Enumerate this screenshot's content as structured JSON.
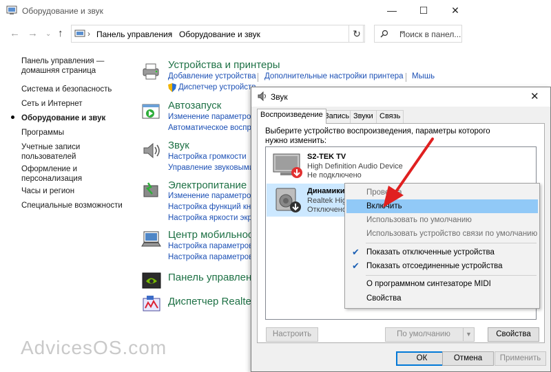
{
  "control_panel": {
    "window_title": "Оборудование и звук",
    "breadcrumb": [
      "Панель управления",
      "Оборудование и звук"
    ],
    "search_placeholder": "Поиск в панел...",
    "sidebar": [
      "Панель управления —",
      "домашняя страница",
      "Система и безопасность",
      "Сеть и Интернет",
      "Оборудование и звук",
      "Программы",
      "Учетные записи",
      "пользователей",
      "Оформление и",
      "персонализация",
      "Часы и регион",
      "Специальные возможности"
    ],
    "categories": [
      {
        "title": "Устройства и принтеры",
        "links": [
          "Добавление устройства",
          "Дополнительные настройки принтера",
          "Мышь",
          "Диспетчер устройств"
        ]
      },
      {
        "title": "Автозапуск",
        "links": [
          "Изменение параметров",
          "Автоматическое воспро"
        ]
      },
      {
        "title": "Звук",
        "links": [
          "Настройка громкости",
          "Управление звуковыми"
        ]
      },
      {
        "title": "Электропитание",
        "links": [
          "Изменение параметров",
          "Настройка функций кно",
          "Настройка яркости экра"
        ]
      },
      {
        "title": "Центр мобильност",
        "links": [
          "Настройка параметров",
          "Настройка параметров"
        ]
      },
      {
        "title": "Панель управлени",
        "links": []
      },
      {
        "title": "Диспетчер Realtek",
        "links": []
      }
    ]
  },
  "sound_dialog": {
    "title": "Звук",
    "tabs": [
      "Воспроизведение",
      "Запись",
      "Звуки",
      "Связь"
    ],
    "instruction": "Выберите устройство воспроизведения, параметры которого нужно изменить:",
    "devices": [
      {
        "name": "S2-TEK TV",
        "description": "High Definition Audio Device",
        "status": "Не подключено"
      },
      {
        "name": "Динамики",
        "description": "Realtek High",
        "status": "Отключено"
      }
    ],
    "buttons": {
      "configure": "Настроить",
      "set_default": "По умолчанию",
      "properties": "Свойства",
      "ok": "ОК",
      "cancel": "Отмена",
      "apply": "Применить"
    }
  },
  "context_menu": {
    "items": [
      {
        "label": "Проверка",
        "disabled": true
      },
      {
        "label": "Включить",
        "highlighted": true
      },
      {
        "label": "Использовать по умолчанию",
        "disabled": true
      },
      {
        "label": "Использовать устройство связи по умолчанию",
        "disabled": true
      },
      {
        "label": "Показать отключенные устройства",
        "checked": true
      },
      {
        "label": "Показать отсоединенные устройства",
        "checked": true
      },
      {
        "label": "О программном синтезаторе MIDI"
      },
      {
        "label": "Свойства"
      }
    ]
  },
  "watermark": "AdvicesOS.com",
  "colors": {
    "link": "#1c50b5",
    "category_title": "#1e7145",
    "menu_highlight": "#91c9f7",
    "selection": "#cce8ff",
    "arrow": "#e02020"
  }
}
